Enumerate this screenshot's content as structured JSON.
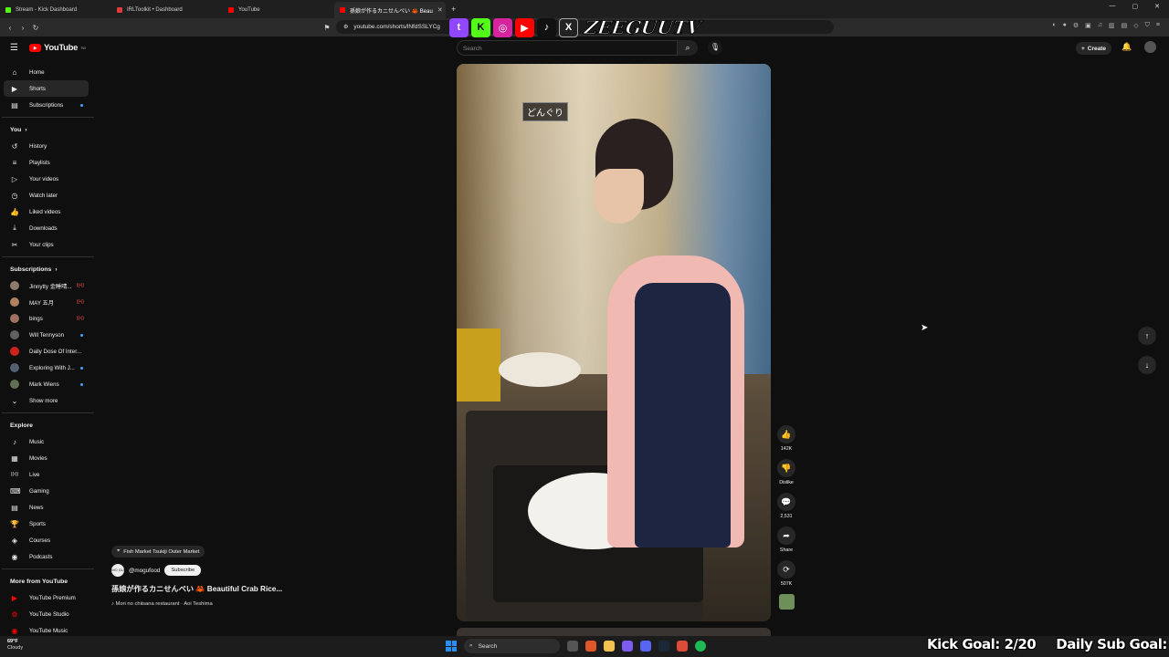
{
  "browser": {
    "tabs": [
      {
        "title": "Stream - Kick Dashboard",
        "color": "#53fc18"
      },
      {
        "title": "IRLToolkit • Dashboard",
        "color": "#e03a3a"
      },
      {
        "title": "YouTube",
        "color": "#ff0000"
      },
      {
        "title": "孫娘が作るカニせんべい 🦀 Beau",
        "color": "#ff0000",
        "active": true
      }
    ],
    "url": "youtube.com/shorts/lNfdSSLYCg"
  },
  "overlay": {
    "brand": "ZEEGUUTV"
  },
  "header": {
    "logo": "YouTube",
    "logo_sup": "TW",
    "search_placeholder": "Search",
    "create_label": "Create"
  },
  "sidebar": {
    "main": [
      {
        "label": "Home",
        "icon": "⌂"
      },
      {
        "label": "Shorts",
        "icon": "▶",
        "active": true
      },
      {
        "label": "Subscriptions",
        "icon": "▤",
        "dot": true
      }
    ],
    "you_header": "You",
    "you": [
      {
        "label": "History",
        "icon": "↺"
      },
      {
        "label": "Playlists",
        "icon": "≡"
      },
      {
        "label": "Your videos",
        "icon": "▷"
      },
      {
        "label": "Watch later",
        "icon": "◷"
      },
      {
        "label": "Liked videos",
        "icon": "👍"
      },
      {
        "label": "Downloads",
        "icon": "⤓"
      },
      {
        "label": "Your clips",
        "icon": "✂"
      }
    ],
    "subs_header": "Subscriptions",
    "subs": [
      {
        "label": "Jinnytty 金睡晴...",
        "live": true,
        "color": "#8c7a6a"
      },
      {
        "label": "MAY 五月",
        "live": true,
        "color": "#b08060"
      },
      {
        "label": "bings",
        "live": true,
        "color": "#a07060"
      },
      {
        "label": "Will Tennyson",
        "dot": true,
        "color": "#606060"
      },
      {
        "label": "Daily Dose Of Inter...",
        "color": "#d02020"
      },
      {
        "label": "Exploring With J...",
        "dot": true,
        "color": "#506070"
      },
      {
        "label": "Mark Wiens",
        "dot": true,
        "color": "#607050"
      }
    ],
    "show_more": "Show more",
    "explore_header": "Explore",
    "explore": [
      {
        "label": "Music",
        "icon": "♪"
      },
      {
        "label": "Movies",
        "icon": "▦"
      },
      {
        "label": "Live",
        "icon": "((•))"
      },
      {
        "label": "Gaming",
        "icon": "⌨"
      },
      {
        "label": "News",
        "icon": "▤"
      },
      {
        "label": "Sports",
        "icon": "🏆"
      },
      {
        "label": "Courses",
        "icon": "◈"
      },
      {
        "label": "Podcasts",
        "icon": "◉"
      }
    ],
    "more_header": "More from YouTube",
    "more": [
      {
        "label": "YouTube Premium"
      },
      {
        "label": "YouTube Studio"
      },
      {
        "label": "YouTube Music"
      }
    ]
  },
  "short": {
    "caption": "どんぐり",
    "location": "Fish Market Tsukiji Outer Market",
    "channel": "@mogufood",
    "channel_avatar": "MO GU",
    "subscribe": "Subscribe",
    "title": "孫娘が作るカニせんべい 🦀 Beautiful Crab Rice...",
    "music": "♪ Mori no chiisana restaurant · Aoi Teshima",
    "likes": "142K",
    "dislike": "Dislike",
    "comments": "2,531",
    "share": "Share",
    "remix": "507K"
  },
  "taskbar": {
    "temp": "69°F",
    "weather": "Cloudy",
    "search": "Search"
  },
  "goals": {
    "kick": "Kick Goal: 2/20",
    "sub": "Daily Sub Goal: 0/70"
  }
}
